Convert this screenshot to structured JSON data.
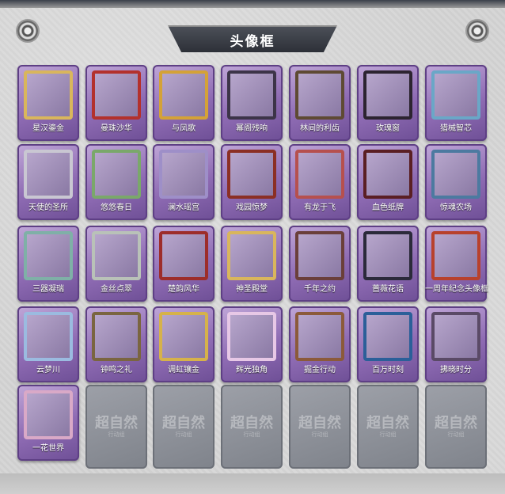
{
  "window_title": "头像框",
  "frame_colors": [
    "#d9b65c",
    "#b3312c",
    "#d4a237",
    "#3c3448",
    "#5e4a33",
    "#2c2430",
    "#6aa7c7",
    "#c9c7d2",
    "#7aa86a",
    "#9e8fc8",
    "#8b2f24",
    "#b6504e",
    "#5a1f23",
    "#4c7aa0",
    "#7fb0a7",
    "#b9c2b8",
    "#9d2d2a",
    "#d9b65c",
    "#6a3f3a",
    "#2b2a3a",
    "#b8412c",
    "#9bbbe0",
    "#7a6540",
    "#d6b24a",
    "#e7c8e6",
    "#8b5a3a",
    "#2b5f99",
    "#5a4a66",
    "#d9a9c7"
  ],
  "frames": [
    {
      "name": "星汉鎏金"
    },
    {
      "name": "曼珠沙华"
    },
    {
      "name": "与凤歌"
    },
    {
      "name": "幂阁残响"
    },
    {
      "name": "林间的利齿"
    },
    {
      "name": "玫瑰窗"
    },
    {
      "name": "猎械智芯"
    },
    {
      "name": "天使的圣所"
    },
    {
      "name": "悠悠春日"
    },
    {
      "name": "澜水瑶宫"
    },
    {
      "name": "戏园惊梦"
    },
    {
      "name": "有龙于飞"
    },
    {
      "name": "血色纸牌"
    },
    {
      "name": "惊魂农场"
    },
    {
      "name": "三器凝瑞"
    },
    {
      "name": "金丝点翠"
    },
    {
      "name": "楚韵风华"
    },
    {
      "name": "神圣殿堂"
    },
    {
      "name": "千年之约"
    },
    {
      "name": "蔷薇花语"
    },
    {
      "name": "一周年纪念头像框"
    },
    {
      "name": "云梦川"
    },
    {
      "name": "钟鸣之礼"
    },
    {
      "name": "调虹镶金"
    },
    {
      "name": "辉光独角"
    },
    {
      "name": "掘金行动"
    },
    {
      "name": "百万时刻"
    },
    {
      "name": "拂晓时分"
    },
    {
      "name": "一花世界"
    }
  ],
  "empty_slot_watermark": "超自然",
  "empty_slot_watermark_sub": "行动组",
  "icons": [
    "gear-icon-left",
    "gear-icon-right"
  ]
}
